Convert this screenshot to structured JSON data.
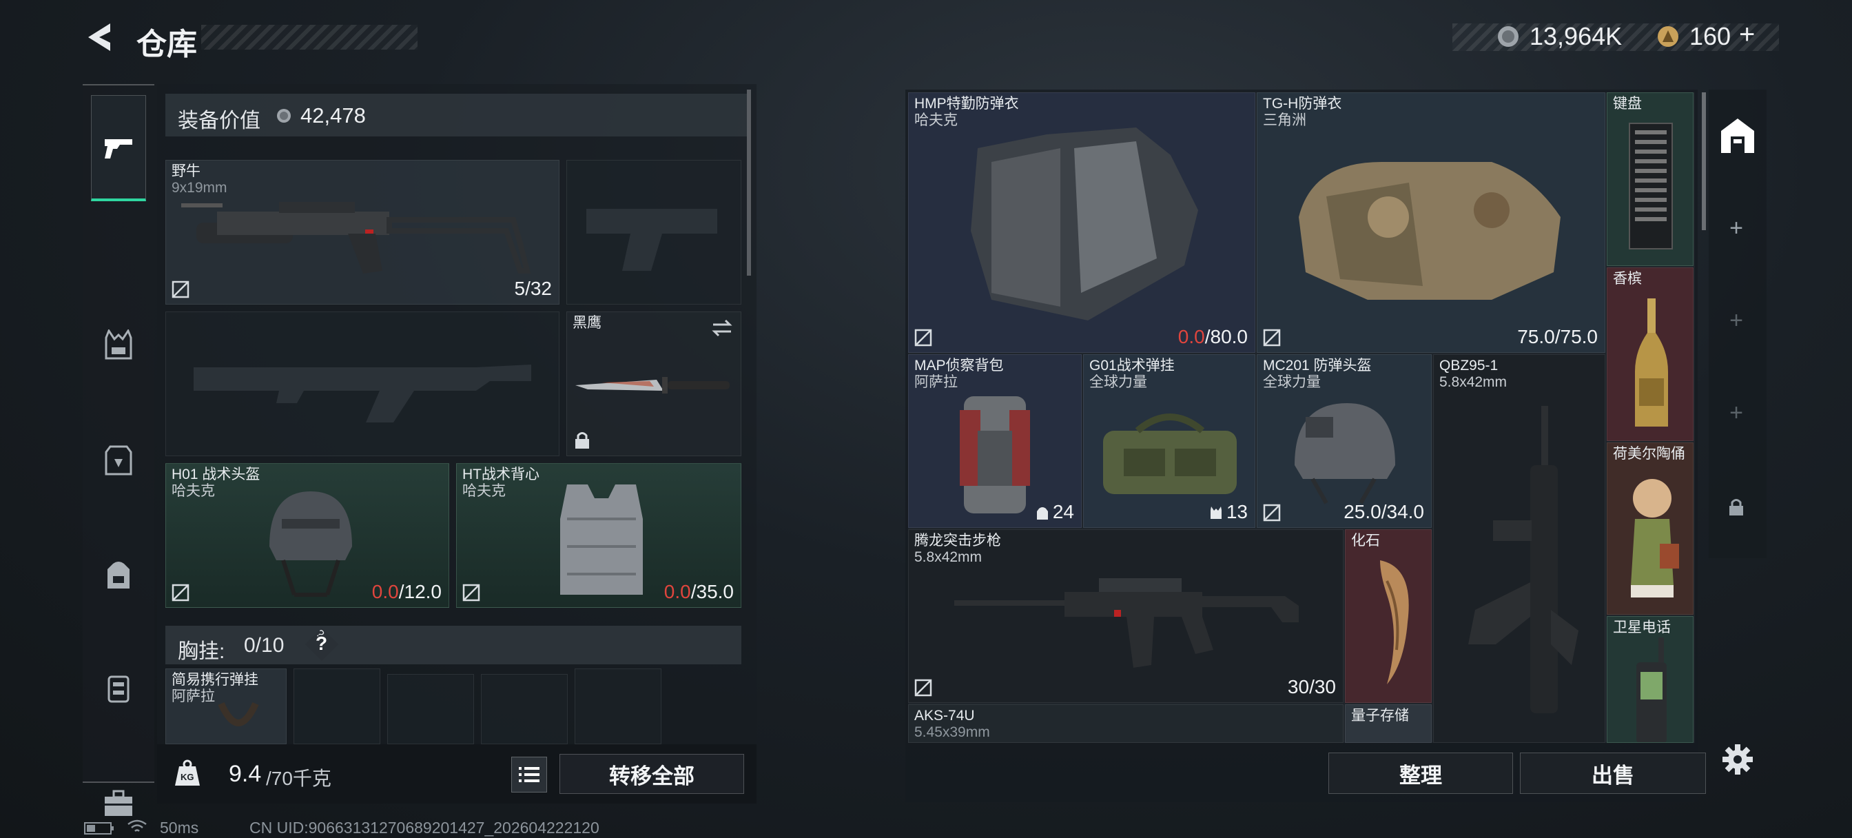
{
  "header": {
    "title": "仓库",
    "currency_amount": "13,964K",
    "premium_amount": "160",
    "premium_add": "+"
  },
  "equipment": {
    "label": "装备价值",
    "value": "42,478"
  },
  "slots": {
    "primary": {
      "name": "野牛",
      "caliber": "9x19mm",
      "ammo": "5/32"
    },
    "melee": {
      "name": "黑鹰"
    },
    "helmet": {
      "name": "H01 战术头盔",
      "brand": "哈夫克",
      "dur_current": "0.0",
      "dur_max": "/12.0"
    },
    "armor": {
      "name": "HT战术背心",
      "brand": "哈夫克",
      "dur_current": "0.0",
      "dur_max": "/35.0"
    }
  },
  "chest_rig": {
    "label": "胸挂:",
    "count": "0/10",
    "help": "?",
    "item_name": "简易携行弹挂",
    "item_brand": "阿萨拉"
  },
  "weight": {
    "current": "9.4",
    "max": "/70千克",
    "unit_icon": "KG"
  },
  "buttons": {
    "transfer_all": "转移全部",
    "sort": "整理",
    "sell": "出售"
  },
  "stash_items": [
    {
      "name": "HMP特勤防弹衣",
      "brand": "哈夫克",
      "dur_current": "0.0",
      "dur_max": "/80.0"
    },
    {
      "name": "TG-H防弹衣",
      "brand": "三角洲",
      "value": "75.0/75.0"
    },
    {
      "name": "键盘"
    },
    {
      "name": "香槟"
    },
    {
      "name": "MAP侦察背包",
      "brand": "阿萨拉",
      "count": "24"
    },
    {
      "name": "G01战术弹挂",
      "brand": "全球力量",
      "count": "13"
    },
    {
      "name": "MC201 防弹头盔",
      "brand": "全球力量",
      "value": "25.0/34.0"
    },
    {
      "name": "QBZ95-1",
      "caliber": "5.8x42mm"
    },
    {
      "name": "荷美尔陶俑"
    },
    {
      "name": "腾龙突击步枪",
      "caliber": "5.8x42mm",
      "ammo": "30/30"
    },
    {
      "name": "化石"
    },
    {
      "name": "卫星电话"
    },
    {
      "name": "AKS-74U",
      "caliber": "5.45x39mm"
    },
    {
      "name": "量子存储"
    }
  ],
  "status": {
    "ping": "50ms",
    "uid": "CN UID:9066313127068920142​7_202604222120"
  },
  "colors": {
    "accent_green": "#2fd6a0",
    "durability_red": "#e0453d"
  }
}
